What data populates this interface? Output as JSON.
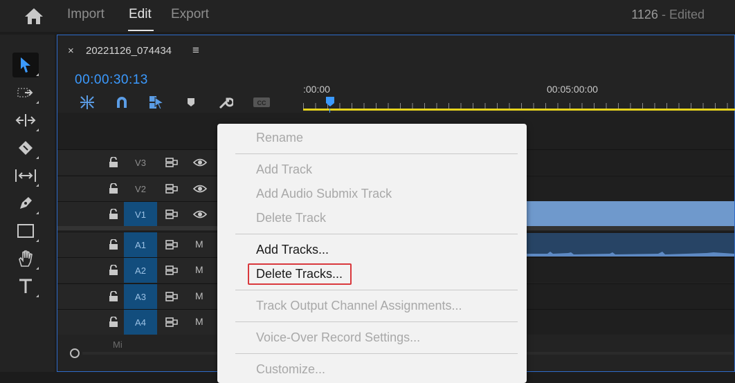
{
  "topbar": {
    "tabs": [
      {
        "label": "Import"
      },
      {
        "label": "Edit"
      },
      {
        "label": "Export"
      }
    ],
    "project_title": "1126",
    "project_status": " - Edited"
  },
  "tools": [
    {
      "icon": "selection-tool-icon",
      "selected": true
    },
    {
      "icon": "track-select-forward-icon"
    },
    {
      "icon": "ripple-edit-icon"
    },
    {
      "icon": "razor-icon"
    },
    {
      "icon": "slip-icon"
    },
    {
      "icon": "pen-icon"
    },
    {
      "icon": "rectangle-icon"
    },
    {
      "icon": "hand-icon"
    },
    {
      "icon": "type-icon"
    }
  ],
  "sequence": {
    "close_glyph": "×",
    "name": "20221126_074434",
    "menu_glyph": "≡",
    "timecode": "00:00:30:13",
    "ruler_labels": [
      ":00:00",
      "00:05:00:00"
    ]
  },
  "timeline_tools": [
    {
      "icon": "nest-icon"
    },
    {
      "icon": "snap-magnet-icon"
    },
    {
      "icon": "linked-selection-icon"
    },
    {
      "icon": "add-marker-icon"
    },
    {
      "icon": "wrench-icon"
    },
    {
      "icon": "captions-icon"
    }
  ],
  "tracks": [
    {
      "name": "V3",
      "type": "video",
      "targeted": false
    },
    {
      "name": "V2",
      "type": "video",
      "targeted": false
    },
    {
      "name": "V1",
      "type": "video",
      "targeted": true
    },
    {
      "name": "A1",
      "type": "audio",
      "targeted": true,
      "mute_label": "M"
    },
    {
      "name": "A2",
      "type": "audio",
      "targeted": true,
      "mute_label": "M"
    },
    {
      "name": "A3",
      "type": "audio",
      "targeted": true,
      "mute_label": "M"
    },
    {
      "name": "A4",
      "type": "audio",
      "targeted": true,
      "mute_label": "M"
    }
  ],
  "mix_label": "Mi",
  "context_menu": {
    "items": [
      {
        "label": "Rename",
        "enabled": false
      },
      {
        "label": "Add Track",
        "enabled": false
      },
      {
        "label": "Add Audio Submix Track",
        "enabled": false
      },
      {
        "label": "Delete Track",
        "enabled": false
      },
      {
        "label": "Add Tracks...",
        "enabled": true
      },
      {
        "label": "Delete Tracks...",
        "enabled": true,
        "highlighted": true
      },
      {
        "label": "Track Output Channel Assignments...",
        "enabled": false
      },
      {
        "label": "Voice-Over Record Settings...",
        "enabled": false
      },
      {
        "label": "Customize...",
        "enabled": false
      }
    ]
  },
  "colors": {
    "accent": "#3b9aff",
    "target_track": "#124d7d",
    "video_clip": "#6f99cc",
    "audio_clip": "#274465",
    "work_area": "#e6d31c",
    "highlight_box": "#d9383c"
  }
}
